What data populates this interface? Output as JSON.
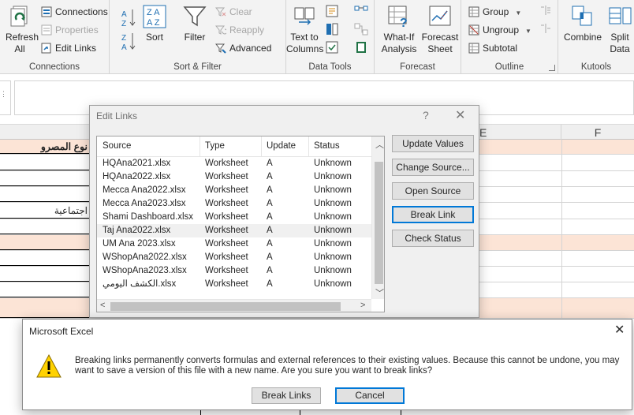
{
  "ribbon": {
    "connections_group": {
      "title": "Connections",
      "refresh_all": "Refresh All",
      "connections": "Connections",
      "properties": "Properties",
      "edit_links": "Edit Links"
    },
    "sort_filter_group": {
      "title": "Sort & Filter",
      "sort": "Sort",
      "filter": "Filter",
      "clear": "Clear",
      "reapply": "Reapply",
      "advanced": "Advanced",
      "sort_az": "A Z",
      "sort_za": "Z A"
    },
    "data_tools_group": {
      "title": "Data Tools",
      "text_to_columns": "Text to Columns"
    },
    "forecast_group": {
      "title": "Forecast",
      "what_if": "What-If Analysis",
      "forecast_sheet": "Forecast Sheet"
    },
    "outline_group": {
      "title": "Outline",
      "group": "Group",
      "ungroup": "Ungroup",
      "subtotal": "Subtotal"
    },
    "kutools_group": {
      "title": "Kutools",
      "combine": "Combine",
      "split_data": "Split Data"
    }
  },
  "sheet": {
    "col_e": "E",
    "col_f": "F",
    "cell_a1": "نوع المصرو",
    "cell_a5": "اجتماعية"
  },
  "edit_links": {
    "title": "Edit Links",
    "help": "?",
    "close": "✕",
    "headers": {
      "source": "Source",
      "type": "Type",
      "update": "Update",
      "status": "Status"
    },
    "rows": [
      {
        "source": "HQAna2021.xlsx",
        "type": "Worksheet",
        "update": "A",
        "status": "Unknown"
      },
      {
        "source": "HQAna2022.xlsx",
        "type": "Worksheet",
        "update": "A",
        "status": "Unknown"
      },
      {
        "source": "Mecca Ana2022.xlsx",
        "type": "Worksheet",
        "update": "A",
        "status": "Unknown"
      },
      {
        "source": "Mecca Ana2023.xlsx",
        "type": "Worksheet",
        "update": "A",
        "status": "Unknown"
      },
      {
        "source": "Shami Dashboard.xlsx",
        "type": "Worksheet",
        "update": "A",
        "status": "Unknown"
      },
      {
        "source": "Taj Ana2022.xlsx",
        "type": "Worksheet",
        "update": "A",
        "status": "Unknown"
      },
      {
        "source": "UM Ana 2023.xlsx",
        "type": "Worksheet",
        "update": "A",
        "status": "Unknown"
      },
      {
        "source": "WShopAna2022.xlsx",
        "type": "Worksheet",
        "update": "A",
        "status": "Unknown"
      },
      {
        "source": "WShopAna2023.xlsx",
        "type": "Worksheet",
        "update": "A",
        "status": "Unknown"
      },
      {
        "source": "الكشف اليومي.xlsx",
        "type": "Worksheet",
        "update": "A",
        "status": "Unknown"
      }
    ],
    "buttons": {
      "update_values": "Update Values",
      "change_source": "Change Source...",
      "open_source": "Open Source",
      "break_link": "Break Link",
      "check_status": "Check Status"
    }
  },
  "message_box": {
    "title": "Microsoft Excel",
    "close": "✕",
    "text": "Breaking links permanently converts formulas and external references to their existing values. Because this cannot be undone, you may want to save a version of this file with a new name. Are you sure you want to break links?",
    "break_links": "Break Links",
    "cancel": "Cancel"
  }
}
